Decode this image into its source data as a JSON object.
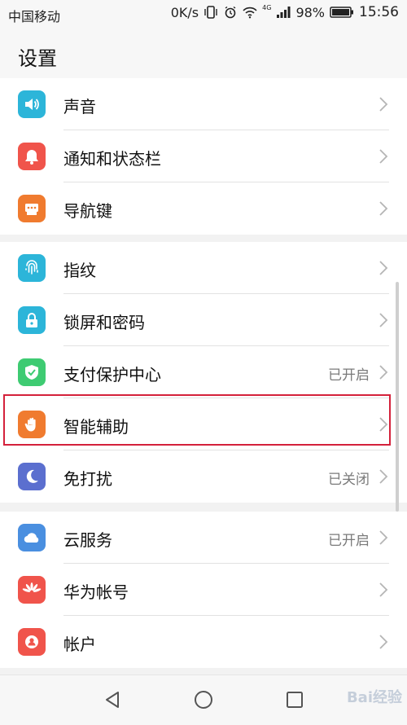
{
  "status_bar": {
    "carrier": "中国移动",
    "speed": "0K/s",
    "battery": "98%",
    "time": "15:56",
    "network": "4G"
  },
  "header": {
    "title": "设置"
  },
  "groups": [
    {
      "items": [
        {
          "label": "声音",
          "status": "",
          "icon": "speaker-icon",
          "color": "#2cb5d9"
        },
        {
          "label": "通知和状态栏",
          "status": "",
          "icon": "bell-icon",
          "color": "#f0544b"
        },
        {
          "label": "导航键",
          "status": "",
          "icon": "navigation-key-icon",
          "color": "#f07b2f"
        }
      ]
    },
    {
      "items": [
        {
          "label": "指纹",
          "status": "",
          "icon": "fingerprint-icon",
          "color": "#2cb5d9"
        },
        {
          "label": "锁屏和密码",
          "status": "",
          "icon": "lock-icon",
          "color": "#2cb5d9"
        },
        {
          "label": "支付保护中心",
          "status": "已开启",
          "icon": "shield-check-icon",
          "color": "#3ecb72"
        },
        {
          "label": "智能辅助",
          "status": "",
          "icon": "hand-icon",
          "color": "#f07b2f"
        },
        {
          "label": "免打扰",
          "status": "已关闭",
          "icon": "moon-icon",
          "color": "#5b6fcf"
        }
      ]
    },
    {
      "items": [
        {
          "label": "云服务",
          "status": "已开启",
          "icon": "cloud-icon",
          "color": "#4a8fe0"
        },
        {
          "label": "华为帐号",
          "status": "",
          "icon": "huawei-logo-icon",
          "color": "#f0544b"
        },
        {
          "label": "帐户",
          "status": "",
          "icon": "person-icon",
          "color": "#f0544b"
        }
      ]
    }
  ],
  "watermark": "Bai经验"
}
